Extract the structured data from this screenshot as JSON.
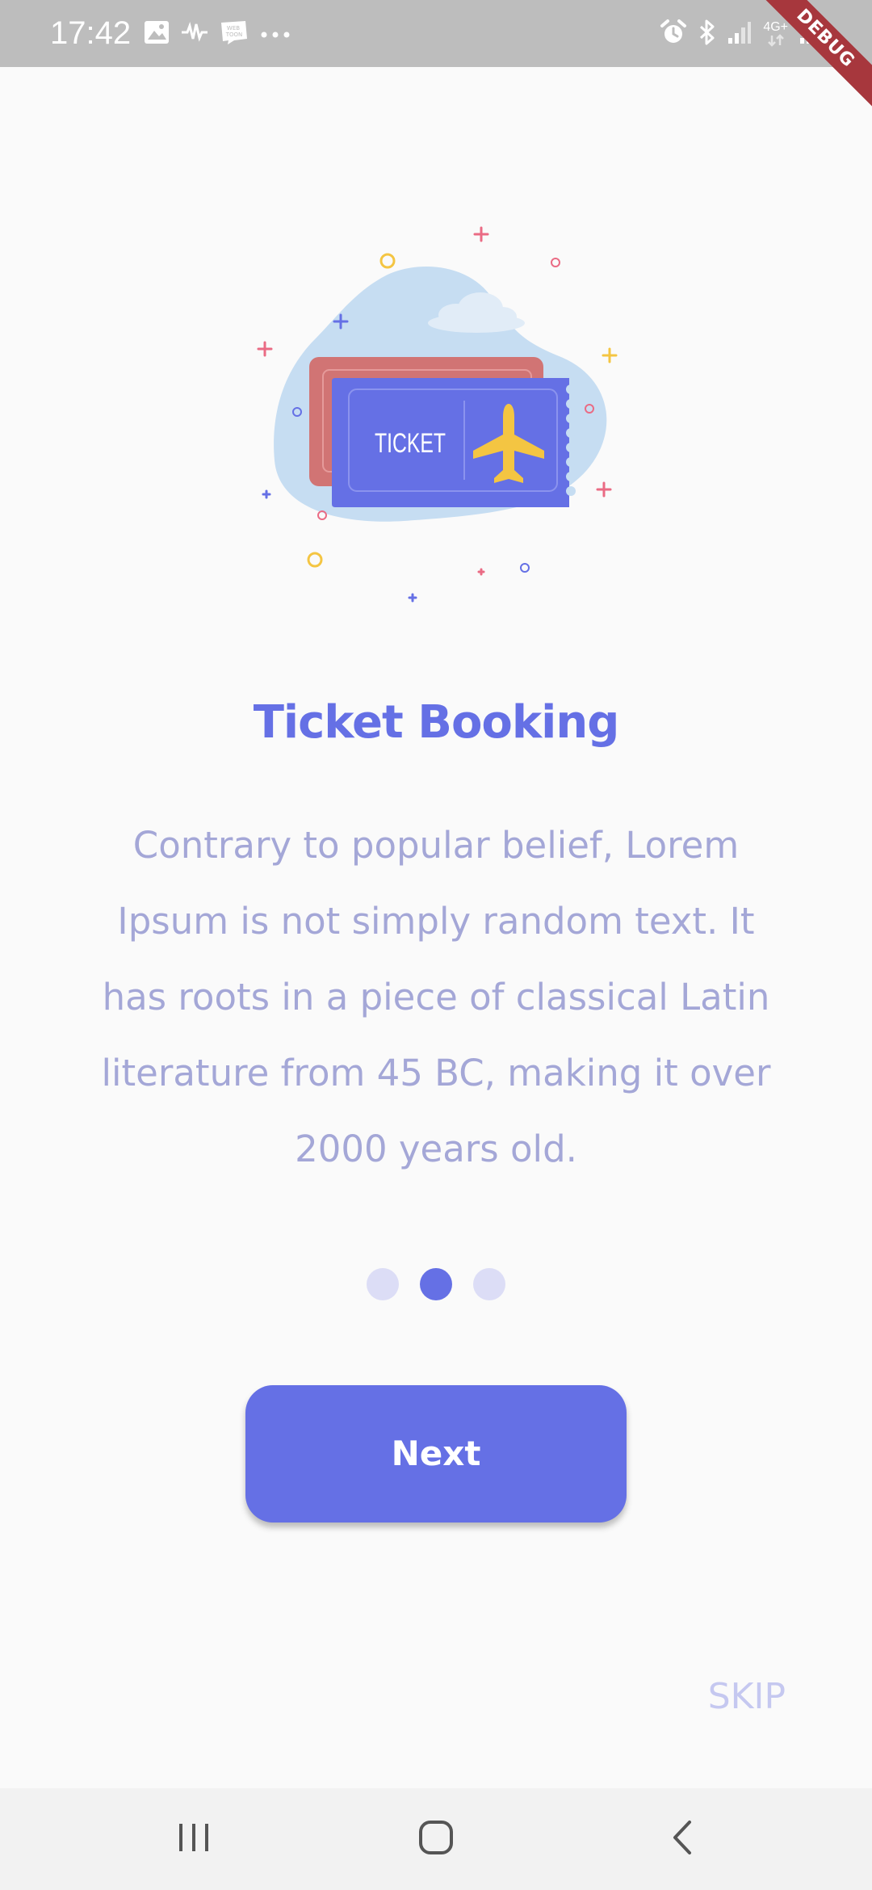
{
  "status_bar": {
    "time": "17:42",
    "network_label": "4G+",
    "icons_left": [
      "image-icon",
      "audio-wave-icon",
      "webtoon-icon",
      "more-dots-icon"
    ],
    "icons_right": [
      "alarm-icon",
      "bluetooth-icon",
      "signal-icon",
      "network-4g-icon",
      "signal-icon-2"
    ]
  },
  "debug_banner": {
    "label": "DEBUG",
    "color": "#a7373d"
  },
  "onboarding": {
    "illustration": {
      "ticket_text": "TICKET",
      "icon": "airplane-ticket-illustration"
    },
    "title": "Ticket Booking",
    "description": "Contrary to popular belief, Lorem Ipsum is not simply random text. It has roots in a piece of classical Latin literature from 45 BC, making it over 2000 years old.",
    "page_count": 3,
    "current_page": 2,
    "next_label": "Next",
    "skip_label": "SKIP"
  },
  "nav_bar": {
    "buttons": [
      "recent-apps-icon",
      "home-icon",
      "back-icon"
    ]
  },
  "colors": {
    "accent": "#6570e5",
    "description_text": "#a4a7d7",
    "skip_text": "#c5c8f0",
    "dot_inactive": "#dcddf6",
    "background": "#fafafa",
    "status_bar": "#bdbdbd"
  }
}
